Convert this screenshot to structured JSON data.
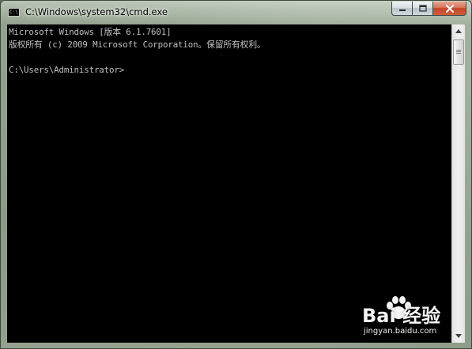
{
  "window": {
    "title": "C:\\Windows\\system32\\cmd.exe",
    "icon_label": "C:\\",
    "icon": "console-app-icon"
  },
  "controls": {
    "minimize_icon": "minimize-icon",
    "maximize_icon": "maximize-icon",
    "close_icon": "close-icon"
  },
  "console": {
    "lines": [
      "Microsoft Windows [版本 6.1.7601]",
      "版权所有 (c) 2009 Microsoft Corporation。保留所有权利。",
      "C:\\Users\\Administrator>"
    ],
    "text_color": "#c0c0c0",
    "background": "#000000"
  },
  "scrollbar": {
    "up_icon": "arrow-up-icon",
    "down_icon": "arrow-down-icon"
  },
  "watermark": {
    "logo": "Bai 经验",
    "url": "jingyan.baidu.com"
  }
}
